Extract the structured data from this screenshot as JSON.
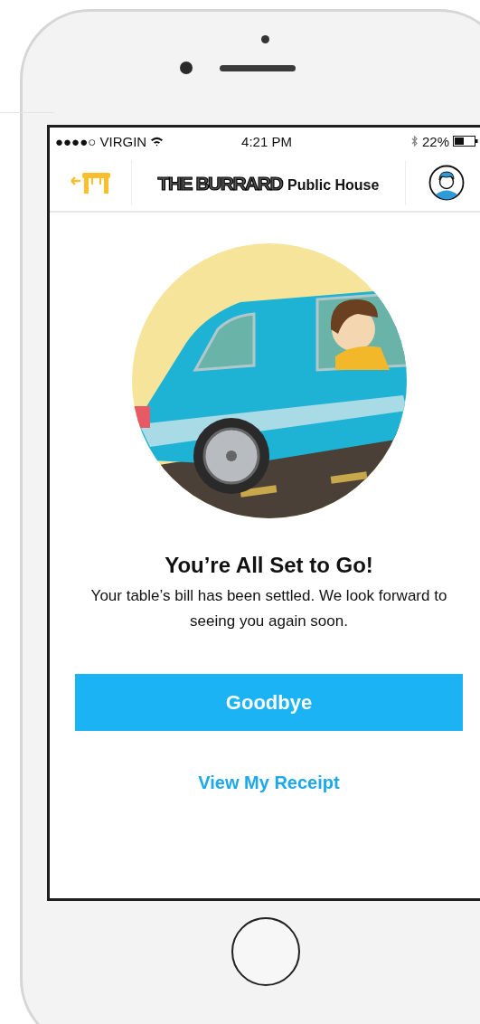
{
  "status_bar": {
    "carrier": "●●●●○ VIRGIN",
    "time": "4:21 PM",
    "battery": "22%"
  },
  "nav": {
    "title": "THE BURRARD",
    "subtitle": "Public House"
  },
  "message": {
    "title": "You’re All Set to Go!",
    "body": "Your table’s bill has been settled. We look forward to seeing you again soon."
  },
  "primary_button": "Goodbye",
  "link": "View My Receipt"
}
